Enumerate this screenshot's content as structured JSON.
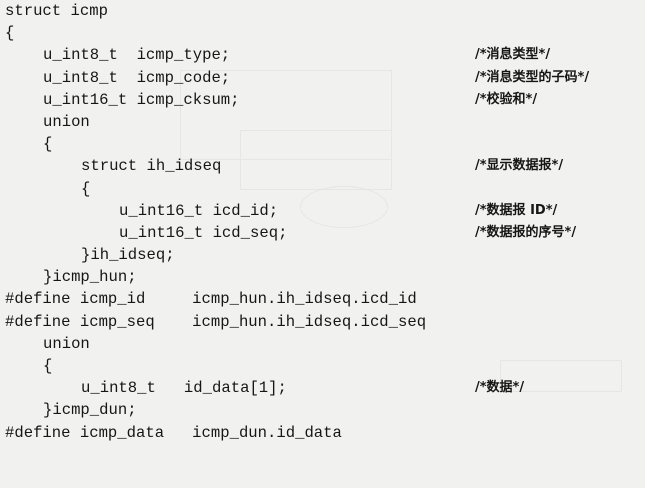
{
  "code": {
    "lines": [
      {
        "text": "struct icmp",
        "comment": ""
      },
      {
        "text": "{",
        "comment": ""
      },
      {
        "text": "u_int8_t  icmp_type;",
        "comment": "/*消息类型*/"
      },
      {
        "text": "u_int8_t  icmp_code;",
        "comment": "/*消息类型的子码*/"
      },
      {
        "text": "u_int16_t icmp_cksum;",
        "comment": "/*校验和*/"
      },
      {
        "text": "union",
        "comment": ""
      },
      {
        "text": "{",
        "comment": ""
      },
      {
        "text": "struct ih_idseq",
        "comment": "/*显示数据报*/"
      },
      {
        "text": "{",
        "comment": ""
      },
      {
        "text": "u_int16_t icd_id;",
        "comment": "/*数据报 ID*/"
      },
      {
        "text": "u_int16_t icd_seq;",
        "comment": "/*数据报的序号*/"
      },
      {
        "text": "}ih_idseq;",
        "comment": ""
      },
      {
        "text": "}icmp_hun;",
        "comment": ""
      },
      {
        "text": "#define icmp_id     icmp_hun.ih_idseq.icd_id",
        "comment": ""
      },
      {
        "text": "#define icmp_seq    icmp_hun.ih_idseq.icd_seq",
        "comment": ""
      },
      {
        "text": "union",
        "comment": ""
      },
      {
        "text": "{",
        "comment": ""
      },
      {
        "text": "u_int8_t   id_data[1];",
        "comment": "/*数据*/"
      },
      {
        "text": "}icmp_dun;",
        "comment": ""
      },
      {
        "text": "#define icmp_data   icmp_dun.id_data",
        "comment": ""
      }
    ]
  }
}
